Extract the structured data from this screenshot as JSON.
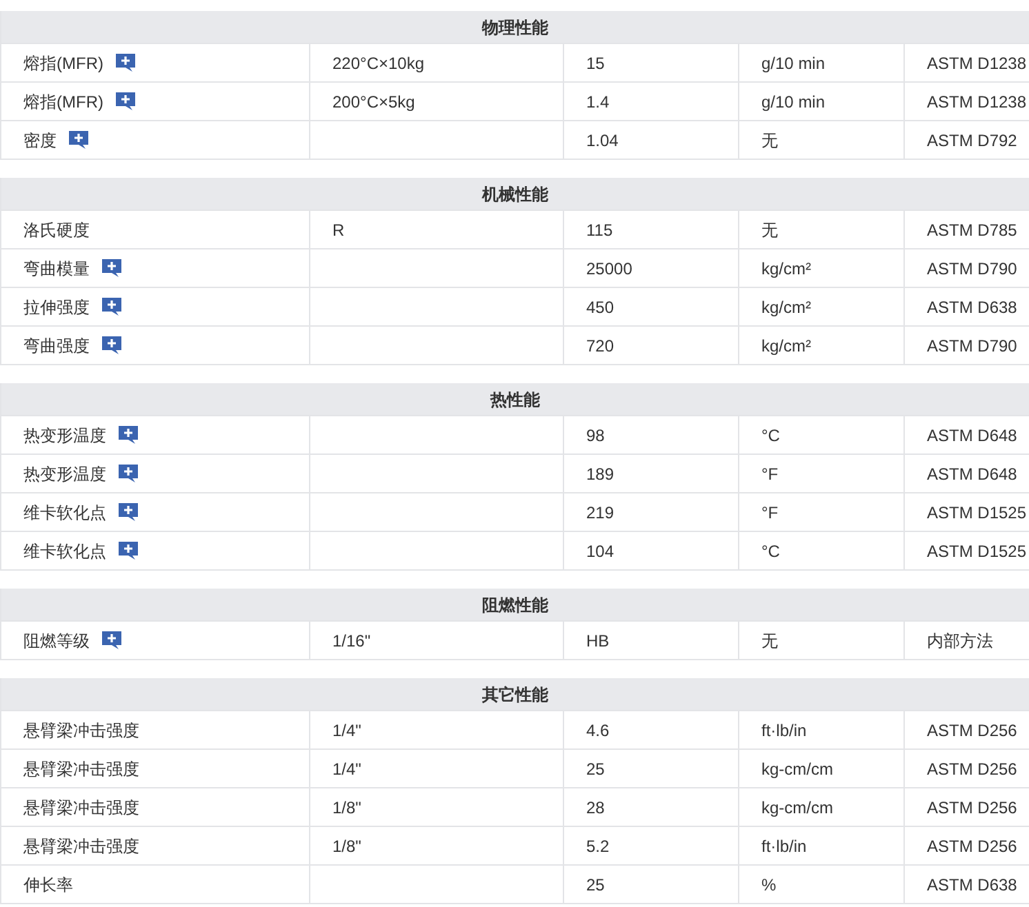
{
  "sections": [
    {
      "title": "物理性能",
      "rows": [
        {
          "name": "熔指(MFR)",
          "info": true,
          "condition": "220°C×10kg",
          "value": "15",
          "unit": "g/10 min",
          "method": "ASTM D1238"
        },
        {
          "name": "熔指(MFR)",
          "info": true,
          "condition": "200°C×5kg",
          "value": "1.4",
          "unit": "g/10 min",
          "method": "ASTM D1238"
        },
        {
          "name": "密度",
          "info": true,
          "value": "1.04",
          "unit": "无",
          "method": "ASTM D792"
        }
      ]
    },
    {
      "title": "机械性能",
      "rows": [
        {
          "name": "洛氏硬度",
          "info": false,
          "condition": "R",
          "value": "115",
          "unit": "无",
          "method": "ASTM D785"
        },
        {
          "name": "弯曲模量",
          "info": true,
          "value": "25000",
          "unit": "kg/cm²",
          "method": "ASTM D790"
        },
        {
          "name": "拉伸强度",
          "info": true,
          "value": "450",
          "unit": "kg/cm²",
          "method": "ASTM D638"
        },
        {
          "name": "弯曲强度",
          "info": true,
          "value": "720",
          "unit": "kg/cm²",
          "method": "ASTM D790"
        }
      ]
    },
    {
      "title": "热性能",
      "rows": [
        {
          "name": "热变形温度",
          "info": true,
          "value": "98",
          "unit": "°C",
          "method": "ASTM D648"
        },
        {
          "name": "热变形温度",
          "info": true,
          "value": "189",
          "unit": "°F",
          "method": "ASTM D648"
        },
        {
          "name": "维卡软化点",
          "info": true,
          "value": "219",
          "unit": "°F",
          "method": "ASTM D1525"
        },
        {
          "name": "维卡软化点",
          "info": true,
          "value": "104",
          "unit": "°C",
          "method": "ASTM D1525"
        }
      ]
    },
    {
      "title": "阻燃性能",
      "rows": [
        {
          "name": "阻燃等级",
          "info": true,
          "condition": "1/16\"",
          "value": "HB",
          "unit": "无",
          "method": "内部方法"
        }
      ]
    },
    {
      "title": "其它性能",
      "rows": [
        {
          "name": "悬臂梁冲击强度",
          "info": false,
          "condition": "1/4\"",
          "value": "4.6",
          "unit": "ft·lb/in",
          "method": "ASTM D256"
        },
        {
          "name": "悬臂梁冲击强度",
          "info": false,
          "condition": "1/4\"",
          "value": "25",
          "unit": "kg-cm/cm",
          "method": "ASTM D256"
        },
        {
          "name": "悬臂梁冲击强度",
          "info": false,
          "condition": "1/8\"",
          "value": "28",
          "unit": "kg-cm/cm",
          "method": "ASTM D256"
        },
        {
          "name": "悬臂梁冲击强度",
          "info": false,
          "condition": "1/8\"",
          "value": "5.2",
          "unit": "ft·lb/in",
          "method": "ASTM D256"
        },
        {
          "name": "伸长率",
          "info": false,
          "value": "25",
          "unit": "%",
          "method": "ASTM D638"
        }
      ]
    }
  ]
}
